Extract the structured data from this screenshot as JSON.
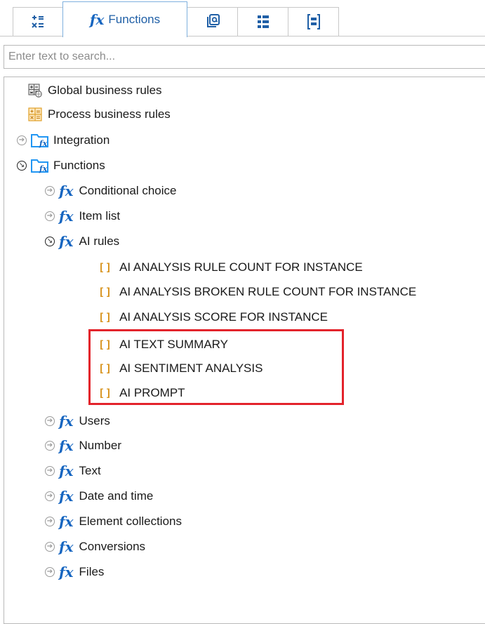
{
  "tabs": [
    {
      "name": "Variables",
      "icon": "variables-icon",
      "active": false
    },
    {
      "name": "Functions",
      "label": "Functions",
      "icon": "fx-icon",
      "active": true
    },
    {
      "name": "Data sources",
      "icon": "data-source-icon",
      "active": false
    },
    {
      "name": "List",
      "icon": "list-icon",
      "active": false
    },
    {
      "name": "Controls",
      "icon": "controls-icon",
      "active": false
    }
  ],
  "fx_symbol": "fx",
  "search": {
    "placeholder": "Enter text to search...",
    "value": ""
  },
  "tree": {
    "global_business_rules": "Global business rules",
    "process_business_rules": "Process business rules",
    "integration": "Integration",
    "functions": "Functions",
    "conditional_choice": "Conditional choice",
    "item_list": "Item list",
    "ai_rules": "AI rules",
    "ai_children": [
      "AI ANALYSIS RULE COUNT FOR INSTANCE",
      "AI ANALYSIS BROKEN RULE COUNT FOR INSTANCE",
      "AI ANALYSIS SCORE FOR INSTANCE",
      "AI TEXT SUMMARY",
      "AI SENTIMENT ANALYSIS",
      "AI PROMPT"
    ],
    "users": "Users",
    "number": "Number",
    "text": "Text",
    "date_and_time": "Date and time",
    "element_collections": "Element collections",
    "conversions": "Conversions",
    "files": "Files"
  },
  "bracket_symbol": "[]",
  "colors": {
    "highlight": "#e3232b",
    "fx_blue": "#1565c0",
    "bracket_orange": "#d89420"
  }
}
